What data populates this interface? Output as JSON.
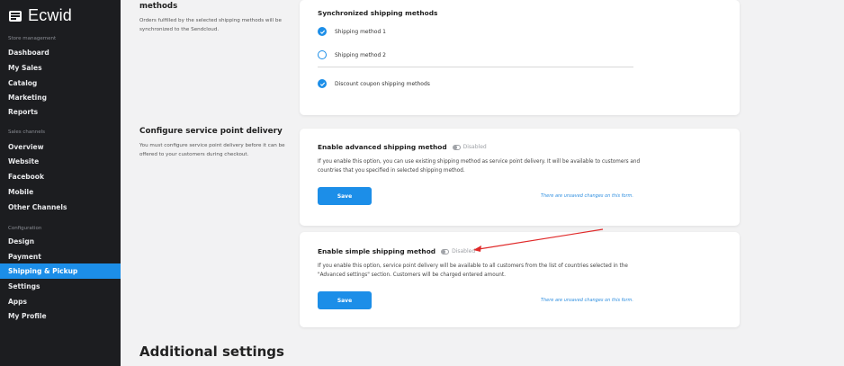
{
  "sidebar": {
    "logo": "Ecwid",
    "sections": [
      {
        "heading": "Store management",
        "items": [
          "Dashboard",
          "My Sales",
          "Catalog",
          "Marketing",
          "Reports"
        ]
      },
      {
        "heading": "Sales channels",
        "items": [
          "Overview",
          "Website",
          "Facebook",
          "Mobile",
          "Other Channels"
        ]
      },
      {
        "heading": "Configuration",
        "items": [
          "Design",
          "Payment",
          "Shipping & Pickup",
          "Settings",
          "Apps",
          "My Profile"
        ]
      }
    ],
    "active_item": "Shipping & Pickup",
    "accent": "#1c8ee8"
  },
  "sync": {
    "title": "methods",
    "desc": "Orders fulfilled by the selected shipping methods will be synchronized to the Sendcloud.",
    "card_title": "Synchronized shipping methods",
    "options": [
      {
        "label": "Shipping method 1",
        "checked": true
      },
      {
        "label": "Shipping method 2",
        "checked": false
      },
      {
        "label": "Discount coupon shipping methods",
        "checked": true
      }
    ]
  },
  "service_point": {
    "title": "Configure service point delivery",
    "desc": "You must configure service point delivery before it can be offered to your customers during checkout.",
    "advanced": {
      "heading": "Enable advanced shipping method",
      "status": "Disabled",
      "text": "If you enable this option, you can use existing shipping method as service point delivery. It will be available to customers and countries that you specified in selected shipping method.",
      "button": "Save",
      "unsaved": "There are unsaved changes on this form."
    },
    "simple": {
      "heading": "Enable simple shipping method",
      "status": "Disabled",
      "text": "If you enable this option, service point delivery will be available to all customers from the list of countries selected in the \"Advanced settings\" section. Customers will be charged entered amount.",
      "button": "Save",
      "unsaved": "There are unsaved changes on this form."
    }
  },
  "additional": {
    "title": "Additional settings"
  }
}
